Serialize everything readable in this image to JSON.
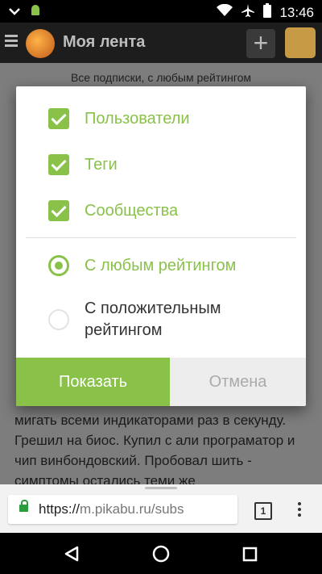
{
  "statusbar": {
    "time": "13:46"
  },
  "appbar": {
    "title": "Моя лента"
  },
  "page": {
    "subs_filter": "Все подписки, с любым рейтингом",
    "post_text": "мигать всеми индикаторами раз в секунду. Грешил на биос. Купил с али програматор и чип винбондовский. Пробовал шить  - симптомы остались теми же"
  },
  "dialog": {
    "checkboxes": [
      {
        "label": "Пользователи",
        "checked": true
      },
      {
        "label": "Теги",
        "checked": true
      },
      {
        "label": "Сообщества",
        "checked": true
      }
    ],
    "radios": [
      {
        "label": "С любым рейтингом",
        "selected": true
      },
      {
        "label": "С положительным рейтингом",
        "selected": false
      }
    ],
    "show_label": "Показать",
    "cancel_label": "Отмена"
  },
  "browser": {
    "url_scheme": "https://",
    "url_rest": "m.pikabu.ru/subs",
    "tab_count": "1"
  },
  "colors": {
    "accent": "#8ac249"
  },
  "icons": [
    "chevron-down-icon",
    "android-icon",
    "wifi-icon",
    "airplane-icon",
    "battery-icon",
    "menu-icon",
    "plus-icon",
    "lock-icon",
    "tabs-icon",
    "more-icon",
    "back-icon",
    "home-icon",
    "recents-icon"
  ]
}
